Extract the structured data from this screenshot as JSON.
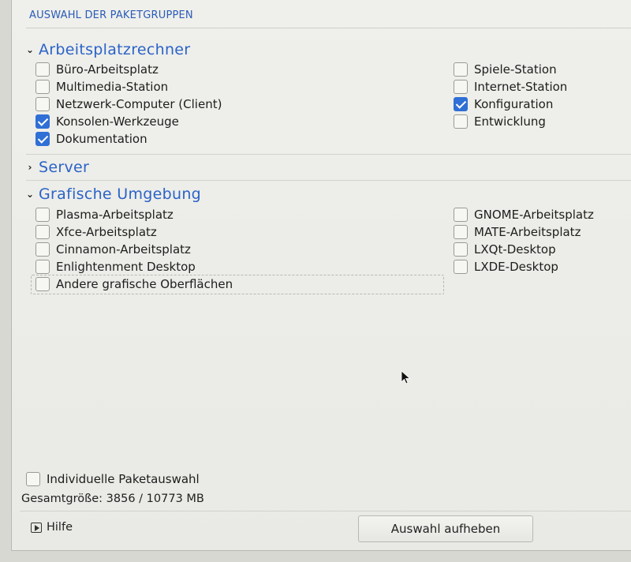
{
  "page_title": "AUSWAHL DER PAKETGRUPPEN",
  "groups": {
    "workstation": {
      "label": "Arbeitsplatzrechner",
      "expanded": true,
      "left": [
        {
          "label": "Büro-Arbeitsplatz",
          "checked": false
        },
        {
          "label": "Multimedia-Station",
          "checked": false
        },
        {
          "label": "Netzwerk-Computer (Client)",
          "checked": false
        },
        {
          "label": "Konsolen-Werkzeuge",
          "checked": true
        },
        {
          "label": "Dokumentation",
          "checked": true
        }
      ],
      "right": [
        {
          "label": "Spiele-Station",
          "checked": false
        },
        {
          "label": "Internet-Station",
          "checked": false
        },
        {
          "label": "Konfiguration",
          "checked": true
        },
        {
          "label": "Entwicklung",
          "checked": false
        }
      ]
    },
    "server": {
      "label": "Server",
      "expanded": false
    },
    "graphical": {
      "label": "Grafische Umgebung",
      "expanded": true,
      "left": [
        {
          "label": "Plasma-Arbeitsplatz",
          "checked": false
        },
        {
          "label": "Xfce-Arbeitsplatz",
          "checked": false
        },
        {
          "label": "Cinnamon-Arbeitsplatz",
          "checked": false
        },
        {
          "label": "Enlightenment Desktop",
          "checked": false
        },
        {
          "label": "Andere grafische Oberflächen",
          "checked": false
        }
      ],
      "right": [
        {
          "label": "GNOME-Arbeitsplatz",
          "checked": false
        },
        {
          "label": "MATE-Arbeitsplatz",
          "checked": false
        },
        {
          "label": "LXQt-Desktop",
          "checked": false
        },
        {
          "label": "LXDE-Desktop",
          "checked": false
        }
      ]
    }
  },
  "individual_selection": {
    "label": "Individuelle Paketauswahl",
    "checked": false
  },
  "total_size": "Gesamtgröße: 3856 / 10773 MB",
  "help_label": "Hilfe",
  "clear_button": "Auswahl aufheben",
  "icons": {
    "expanded": "chevron-down-icon",
    "collapsed": "chevron-right-icon",
    "help": "play-box-icon",
    "cursor": "mouse-pointer-icon"
  },
  "colors": {
    "accent": "#2a63c8",
    "checkbox_checked": "#2f6fd6"
  }
}
